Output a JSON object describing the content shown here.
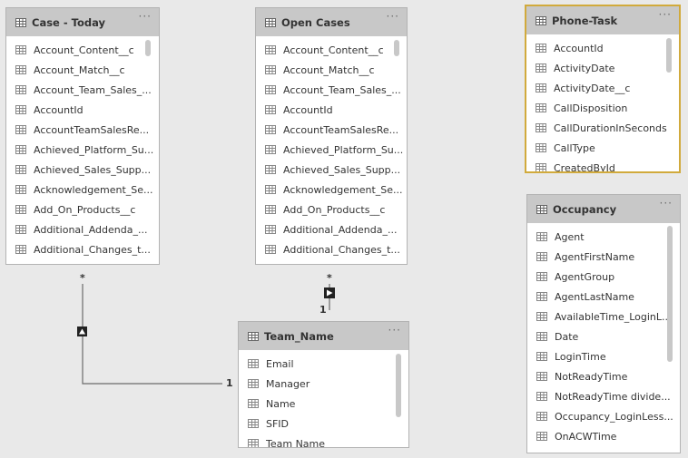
{
  "tables": {
    "case_today": {
      "title": "Case - Today",
      "more": "···",
      "fields": [
        "Account_Content__c",
        "Account_Match__c",
        "Account_Team_Sales_...",
        "AccountId",
        "AccountTeamSalesRe...",
        "Achieved_Platform_Su...",
        "Achieved_Sales_Supp...",
        "Acknowledgement_Se...",
        "Add_On_Products__c",
        "Additional_Addenda_...",
        "Additional_Changes_t..."
      ]
    },
    "open_cases": {
      "title": "Open Cases",
      "more": "···",
      "fields": [
        "Account_Content__c",
        "Account_Match__c",
        "Account_Team_Sales_...",
        "AccountId",
        "AccountTeamSalesRe...",
        "Achieved_Platform_Su...",
        "Achieved_Sales_Supp...",
        "Acknowledgement_Se...",
        "Add_On_Products__c",
        "Additional_Addenda_...",
        "Additional_Changes_t..."
      ]
    },
    "phone_task": {
      "title": "Phone-Task",
      "more": "···",
      "fields": [
        "AccountId",
        "ActivityDate",
        "ActivityDate__c",
        "CallDisposition",
        "CallDurationInSeconds",
        "CallType",
        "CreatedById"
      ]
    },
    "occupancy": {
      "title": "Occupancy",
      "more": "···",
      "fields": [
        "Agent",
        "AgentFirstName",
        "AgentGroup",
        "AgentLastName",
        "AvailableTime_LoginL...",
        "Date",
        "LoginTime",
        "NotReadyTime",
        "NotReadyTime divide...",
        "Occupancy_LoginLess...",
        "OnACWTime"
      ]
    },
    "team_name": {
      "title": "Team_Name",
      "more": "···",
      "fields": [
        "Email",
        "Manager",
        "Name",
        "SFID",
        "Team Name"
      ]
    }
  },
  "relationships": {
    "case_team": {
      "many": "*",
      "one": "1"
    },
    "open_team": {
      "many": "*",
      "one": "1"
    }
  },
  "colors": {
    "canvas": "#e9e9e9",
    "header": "#c8c8c8",
    "selected_border": "#d1aa3c",
    "line": "#6b6b6b"
  }
}
